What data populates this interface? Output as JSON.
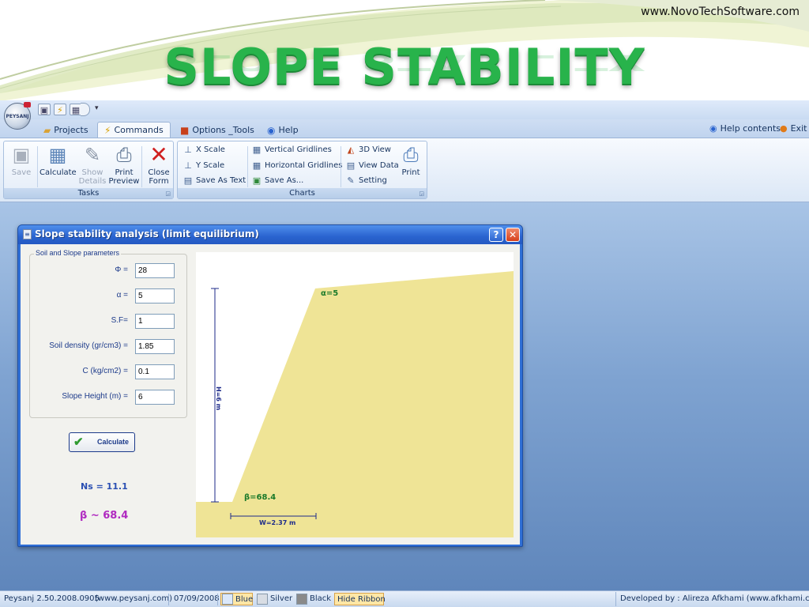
{
  "slide": {
    "url": "www.NovoTechSoftware.com",
    "title": "SLOPE  STABILITY"
  },
  "quick_access": {
    "orb_label": "PEYSANJ",
    "dropdown_glyph": "▾"
  },
  "tabs": [
    {
      "label": "Projects",
      "icon": "folder-icon"
    },
    {
      "label": "Commands",
      "icon": "lightning-icon",
      "active": true
    },
    {
      "label": "Options _Tools",
      "icon": "palette-icon"
    },
    {
      "label": "Help",
      "icon": "help-icon"
    }
  ],
  "header_links": {
    "help_contents": "Help contents",
    "exit": "Exit"
  },
  "ribbon": {
    "tasks": {
      "label": "Tasks",
      "save": "Save",
      "calculate": "Calculate",
      "show": "Show",
      "details": "Details",
      "print": "Print",
      "preview": "Preview",
      "close": "Close",
      "form": "Form"
    },
    "charts": {
      "label": "Charts",
      "x_scale": "X Scale",
      "y_scale": "Y Scale",
      "save_as_text": "Save As Text",
      "vertical_gridlines": "Vertical Gridlines",
      "horizontal_gridlines": "Horizontal Gridlines",
      "save_as": "Save As...",
      "view_3d": "3D View",
      "view_data": "View Data",
      "setting": "Setting",
      "print": "Print"
    }
  },
  "dialog": {
    "title": "Slope stability analysis (limit equilibrium)",
    "help_glyph": "?",
    "close_glyph": "✕",
    "group_legend": "Soil and Slope parameters",
    "params": [
      {
        "label": "Φ =",
        "value": "28"
      },
      {
        "label": "α =",
        "value": "5"
      },
      {
        "label": "S.F=",
        "value": "1"
      },
      {
        "label": "Soil density (gr/cm3) =",
        "value": "1.85"
      },
      {
        "label": "C (kg/cm2) =",
        "value": "0.1"
      },
      {
        "label": "Slope Height (m) =",
        "value": "6"
      }
    ],
    "calculate_label": "Calculate",
    "ns_result": "Ns = 11.1",
    "beta_result": "β ~ 68.4"
  },
  "diagram": {
    "alpha_label": "α=5",
    "beta_label": "β=68.4",
    "height_label": "H=6 m",
    "width_label": "W=2.37 m",
    "soil_color": "#efe496"
  },
  "status_bar": {
    "version": "Peysanj 2.50.2008.0905",
    "website": "(www.peysanj.com)",
    "date": "07/09/2008",
    "blue": "Blue",
    "silver": "Silver",
    "black": "Black",
    "hide_ribbon": "Hide Ribbon",
    "developer": "Developed by : Alireza Afkhami (www.afkhami.com)"
  },
  "colors": {
    "accent_green": "#28b34b",
    "dialog_title": "#2a63cf",
    "label_blue": "#1c3a8a",
    "beta_magenta": "#b02ac0"
  }
}
